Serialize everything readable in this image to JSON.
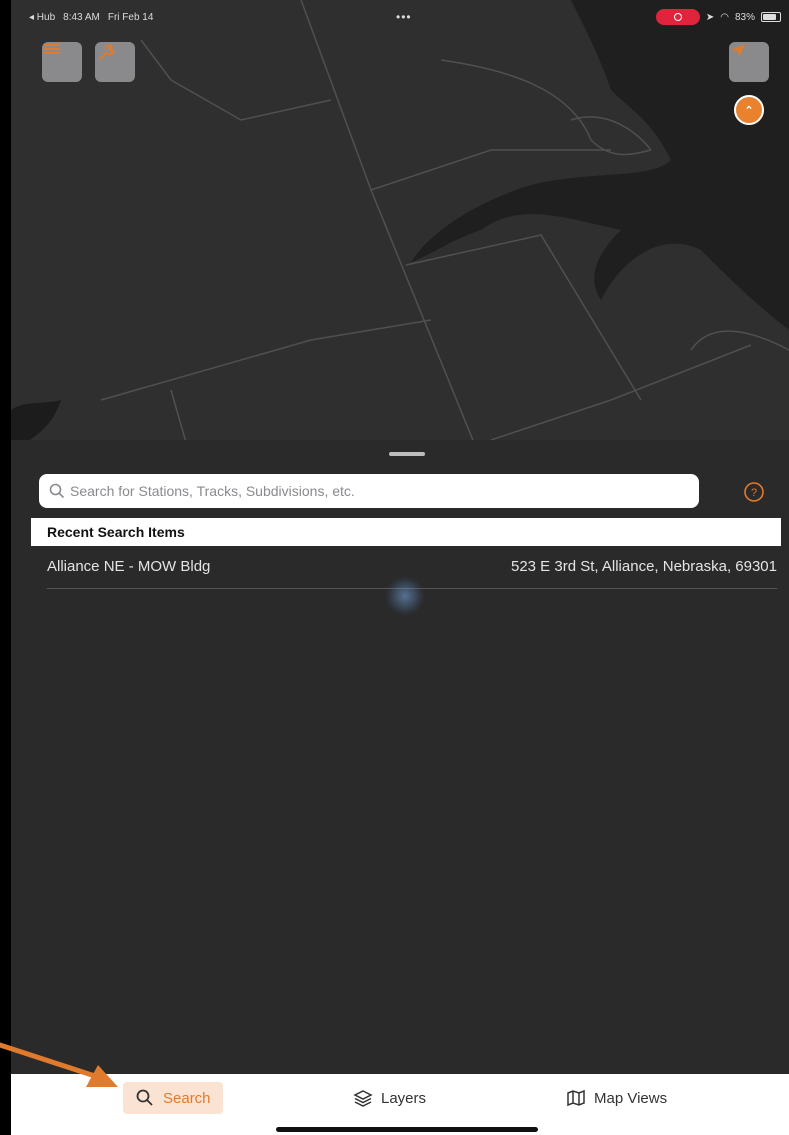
{
  "status_bar": {
    "back_app": "◂ Hub",
    "time": "8:43 AM",
    "date": "Fri Feb 14",
    "battery": "83%"
  },
  "search": {
    "placeholder": "Search for Stations, Tracks, Subdivisions, etc."
  },
  "recent": {
    "header": "Recent Search Items",
    "items": [
      {
        "name": "Alliance NE - MOW Bldg",
        "address": "523 E 3rd St, Alliance, Nebraska, 69301"
      }
    ]
  },
  "tabs": [
    {
      "label": "Search",
      "icon": "search-icon",
      "active": true
    },
    {
      "label": "Layers",
      "icon": "layers-icon",
      "active": false
    },
    {
      "label": "Map Views",
      "icon": "map-icon",
      "active": false
    }
  ],
  "colors": {
    "accent": "#e07a2c",
    "map_background": "#2f2f30",
    "record_pill": "#e0243b"
  }
}
